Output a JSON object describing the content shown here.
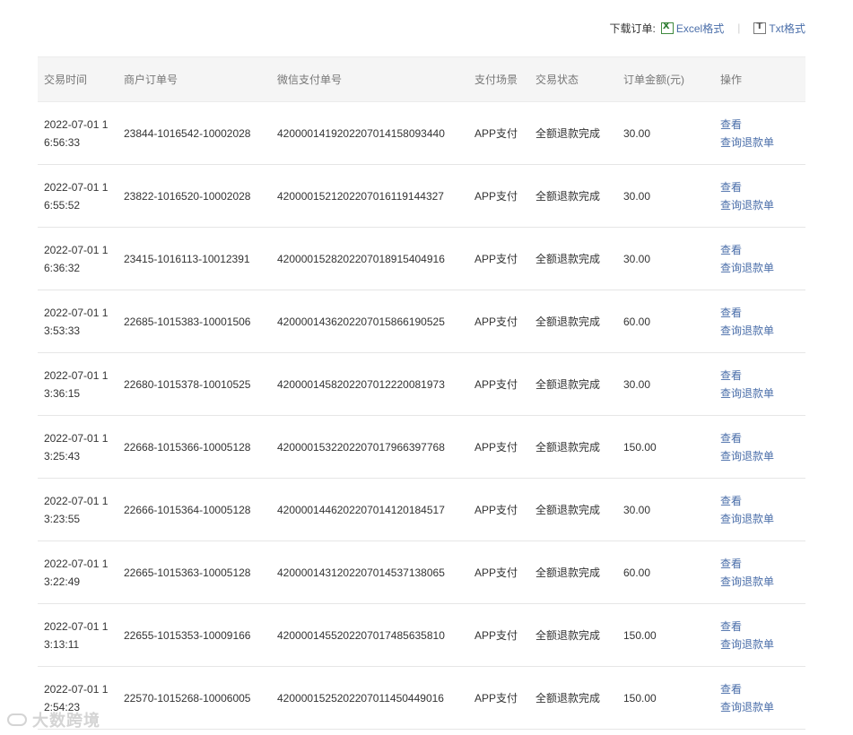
{
  "download": {
    "label": "下载订单:",
    "excel_label": "Excel格式",
    "separator": "|",
    "txt_label": "Txt格式"
  },
  "table": {
    "headers": {
      "time": "交易时间",
      "merchant_order": "商户订单号",
      "wechat_order": "微信支付单号",
      "scene": "支付场景",
      "status": "交易状态",
      "amount": "订单金额(元)",
      "action": "操作"
    },
    "rows": [
      {
        "time": "2022-07-01 16:56:33",
        "merchant_order": "23844-1016542-10002028",
        "wechat_order": "4200001419202207014158093440",
        "scene": "APP支付",
        "status": "全额退款完成",
        "amount": "30.00",
        "view": "查看",
        "refund": "查询退款单"
      },
      {
        "time": "2022-07-01 16:55:52",
        "merchant_order": "23822-1016520-10002028",
        "wechat_order": "4200001521202207016119144327",
        "scene": "APP支付",
        "status": "全额退款完成",
        "amount": "30.00",
        "view": "查看",
        "refund": "查询退款单"
      },
      {
        "time": "2022-07-01 16:36:32",
        "merchant_order": "23415-1016113-10012391",
        "wechat_order": "4200001528202207018915404916",
        "scene": "APP支付",
        "status": "全额退款完成",
        "amount": "30.00",
        "view": "查看",
        "refund": "查询退款单"
      },
      {
        "time": "2022-07-01 13:53:33",
        "merchant_order": "22685-1015383-10001506",
        "wechat_order": "4200001436202207015866190525",
        "scene": "APP支付",
        "status": "全额退款完成",
        "amount": "60.00",
        "view": "查看",
        "refund": "查询退款单"
      },
      {
        "time": "2022-07-01 13:36:15",
        "merchant_order": "22680-1015378-10010525",
        "wechat_order": "4200001458202207012220081973",
        "scene": "APP支付",
        "status": "全额退款完成",
        "amount": "30.00",
        "view": "查看",
        "refund": "查询退款单"
      },
      {
        "time": "2022-07-01 13:25:43",
        "merchant_order": "22668-1015366-10005128",
        "wechat_order": "4200001532202207017966397768",
        "scene": "APP支付",
        "status": "全额退款完成",
        "amount": "150.00",
        "view": "查看",
        "refund": "查询退款单"
      },
      {
        "time": "2022-07-01 13:23:55",
        "merchant_order": "22666-1015364-10005128",
        "wechat_order": "4200001446202207014120184517",
        "scene": "APP支付",
        "status": "全额退款完成",
        "amount": "30.00",
        "view": "查看",
        "refund": "查询退款单"
      },
      {
        "time": "2022-07-01 13:22:49",
        "merchant_order": "22665-1015363-10005128",
        "wechat_order": "4200001431202207014537138065",
        "scene": "APP支付",
        "status": "全额退款完成",
        "amount": "60.00",
        "view": "查看",
        "refund": "查询退款单"
      },
      {
        "time": "2022-07-01 13:13:11",
        "merchant_order": "22655-1015353-10009166",
        "wechat_order": "4200001455202207017485635810",
        "scene": "APP支付",
        "status": "全额退款完成",
        "amount": "150.00",
        "view": "查看",
        "refund": "查询退款单"
      },
      {
        "time": "2022-07-01 12:54:23",
        "merchant_order": "22570-1015268-10006005",
        "wechat_order": "4200001525202207011450449016",
        "scene": "APP支付",
        "status": "全额退款完成",
        "amount": "150.00",
        "view": "查看",
        "refund": "查询退款单"
      }
    ]
  },
  "watermark": {
    "text": "大数跨境"
  },
  "colors": {
    "link": "#4a6ea9",
    "header_bg": "#f5f5f5",
    "border": "#e6e6e6"
  }
}
